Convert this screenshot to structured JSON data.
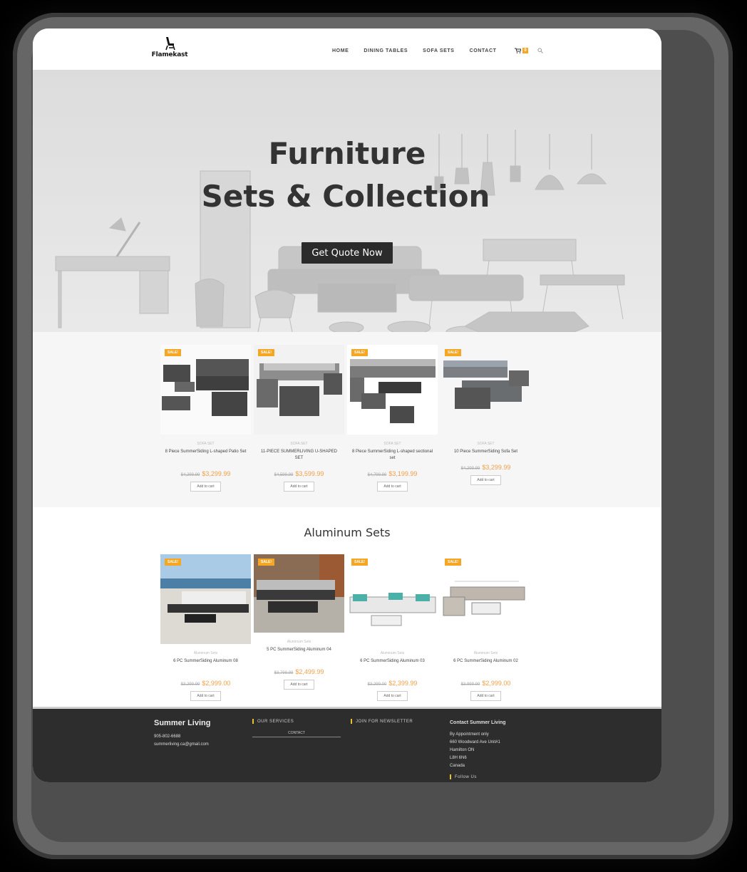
{
  "header": {
    "logo_text": "Flamekast",
    "nav": [
      "HOME",
      "DINING TABLES",
      "SOFA SETS",
      "CONTACT"
    ],
    "cart_count": "0"
  },
  "hero": {
    "title_line1": "Furniture",
    "title_line2": "Sets & Collection",
    "button_label": "Get Quote Now"
  },
  "featured": {
    "products": [
      {
        "badge": "SALE!",
        "category": "SOFA SET",
        "name": "8 Piece SummerSiding L-shaped Patio Set",
        "old_price": "$4,299.99",
        "price": "$3,299.99",
        "button": "Add to cart"
      },
      {
        "badge": "SALE!",
        "category": "SOFA SET",
        "name": "11-PIECE SUMMERLIVING U-SHAPED SET",
        "old_price": "$4,599.99",
        "price": "$3,599.99",
        "button": "Add to cart"
      },
      {
        "badge": "SALE!",
        "category": "SOFA SET",
        "name": "8 Piece SummerSiding L-shaped sectional set",
        "old_price": "$4,799.99",
        "price": "$3,199.99",
        "button": "Add to cart"
      },
      {
        "badge": "SALE!",
        "category": "SOFA SET",
        "name": "10 Piece SummerSiding Sofa Set",
        "old_price": "$4,299.99",
        "price": "$3,299.99",
        "button": "Add to cart"
      }
    ]
  },
  "aluminum": {
    "title": "Aluminum Sets",
    "products": [
      {
        "badge": "SALE!",
        "category": "Aluminum Sets",
        "name": "6 PC SummerSiding Aluminum 08",
        "old_price": "$3,299.99",
        "price": "$2,999.00",
        "button": "Add to cart"
      },
      {
        "badge": "SALE!",
        "category": "Aluminum Sets",
        "name": "5 PC SummerSiding Aluminum 04",
        "old_price": "$3,799.99",
        "price": "$2,499.99",
        "button": "Add to cart"
      },
      {
        "badge": "SALE!",
        "category": "Aluminum Sets",
        "name": "6 PC SummerSiding Aluminum 03",
        "old_price": "$3,299.00",
        "price": "$2,399.99",
        "button": "Add to cart"
      },
      {
        "badge": "SALE!",
        "category": "Aluminum Sets",
        "name": "6 PC SummerSiding Aluminum 02",
        "old_price": "$3,999.99",
        "price": "$2,999.00",
        "button": "Add to cart"
      }
    ]
  },
  "footer": {
    "brand": "Summer Living",
    "phone": "905-802-6688",
    "email": "summerliving.ca@gmail.com",
    "services_head": "OUR SERVICES",
    "services_link": "CONTACT",
    "newsletter_head": "JOIN FOR NEWSLETTER",
    "contact_title": "Contact Summer Living",
    "contact_lines": [
      "By Appointment only",
      "660 Woodward Ave Unit#1",
      "Hamilton ON",
      "L8H 6N6",
      "Canada"
    ],
    "follow": "Follow Us"
  },
  "colors": {
    "accent": "#f5a623",
    "footer_bg": "#2d2d2d",
    "price": "#f0a04b",
    "button_dark": "#2b2b2b"
  }
}
